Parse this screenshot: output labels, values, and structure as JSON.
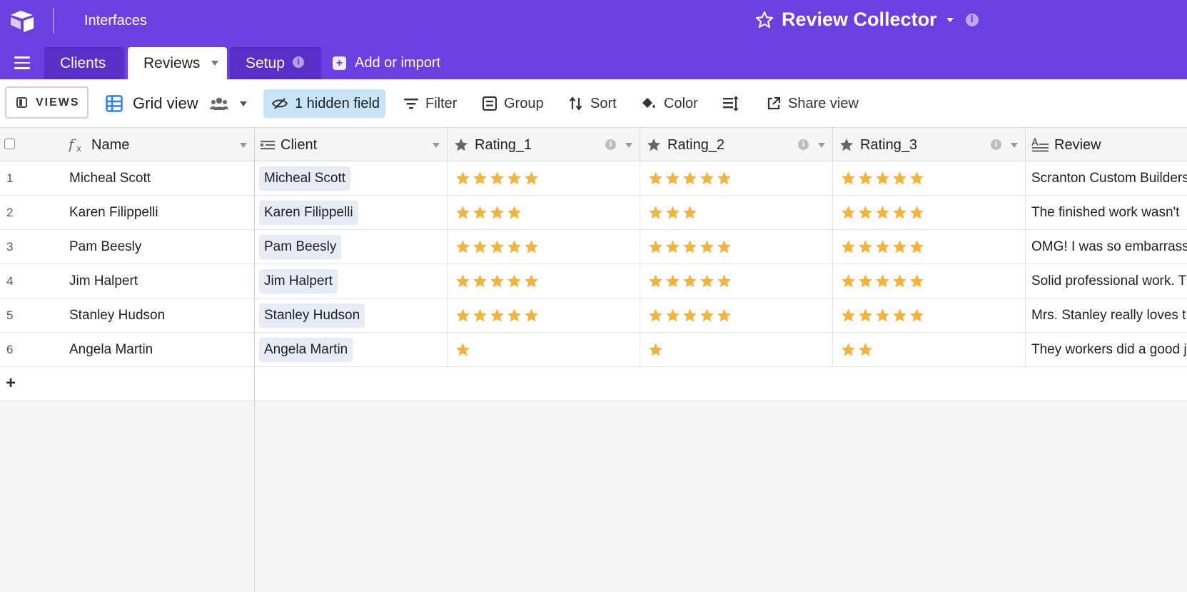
{
  "header": {
    "section_label": "Interfaces",
    "base_title": "Review Collector",
    "tabs": [
      {
        "label": "Clients"
      },
      {
        "label": "Reviews"
      },
      {
        "label": "Setup"
      }
    ],
    "add_import_label": "Add or import"
  },
  "toolbar": {
    "views_label": "VIEWS",
    "view_name": "Grid view",
    "hidden_fields_label": "1 hidden field",
    "filter_label": "Filter",
    "group_label": "Group",
    "sort_label": "Sort",
    "color_label": "Color",
    "share_label": "Share view"
  },
  "grid": {
    "columns": [
      {
        "label": "Name",
        "icon": "formula-icon"
      },
      {
        "label": "Client",
        "icon": "link-icon"
      },
      {
        "label": "Rating_1",
        "icon": "star-icon"
      },
      {
        "label": "Rating_2",
        "icon": "star-icon"
      },
      {
        "label": "Rating_3",
        "icon": "star-icon"
      },
      {
        "label": "Review",
        "icon": "long-text-icon"
      }
    ],
    "rows": [
      {
        "num": "1",
        "name": "Micheal Scott",
        "client": "Micheal Scott",
        "rating_1": 5,
        "rating_2": 5,
        "rating_3": 5,
        "review": "Scranton Custom Builders"
      },
      {
        "num": "2",
        "name": "Karen Filippelli",
        "client": "Karen Filippelli",
        "rating_1": 4,
        "rating_2": 3,
        "rating_3": 5,
        "review": "The finished work wasn't"
      },
      {
        "num": "3",
        "name": "Pam Beesly",
        "client": "Pam Beesly",
        "rating_1": 5,
        "rating_2": 5,
        "rating_3": 5,
        "review": "OMG! I was so embarrass"
      },
      {
        "num": "4",
        "name": "Jim Halpert",
        "client": "Jim Halpert",
        "rating_1": 5,
        "rating_2": 5,
        "rating_3": 5,
        "review": "Solid professional work. T"
      },
      {
        "num": "5",
        "name": "Stanley Hudson",
        "client": "Stanley Hudson",
        "rating_1": 5,
        "rating_2": 5,
        "rating_3": 5,
        "review": "Mrs. Stanley really loves t"
      },
      {
        "num": "6",
        "name": "Angela Martin",
        "client": "Angela Martin",
        "rating_1": 1,
        "rating_2": 1,
        "rating_3": 2,
        "review": "They workers did a good j"
      }
    ],
    "add_row_label": "+"
  },
  "colors": {
    "header_purple": "#6b3fe0",
    "tab_inactive": "#5a2fc7",
    "star_gold": "#f4b33a",
    "hidden_field_bg": "#c8e4f8",
    "grid_icon_blue": "#2d7ff9"
  }
}
